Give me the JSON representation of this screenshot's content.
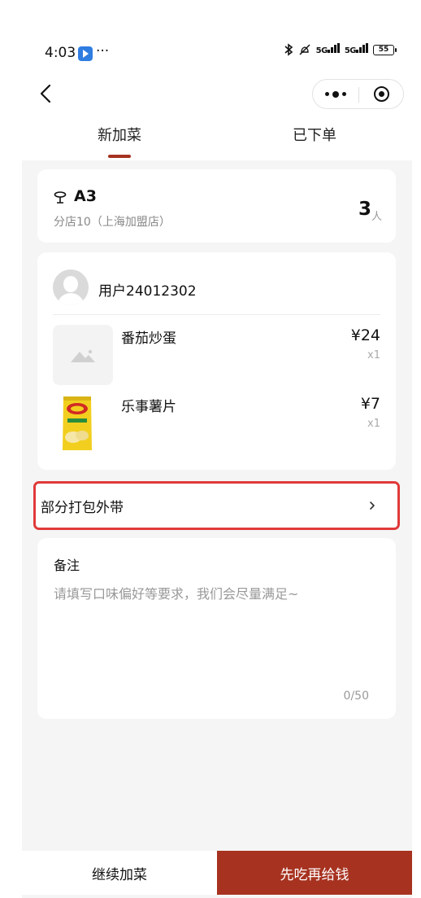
{
  "status_bar": {
    "time": "4:03",
    "dots": "···",
    "network_1": "5G",
    "network_2": "5G",
    "battery": "55"
  },
  "tabs": [
    {
      "label": "新加菜",
      "active": true
    },
    {
      "label": "已下单",
      "active": false
    }
  ],
  "table": {
    "name": "A3",
    "shop": "分店10（上海加盟店）",
    "guest_count": "3",
    "guest_unit": "人"
  },
  "order": {
    "username": "用户24012302",
    "items": [
      {
        "name": "番茄炒蛋",
        "price": "¥24",
        "qty": "x1",
        "thumb": "placeholder-image"
      },
      {
        "name": "乐事薯片",
        "price": "¥7",
        "qty": "x1",
        "thumb": "chips-photo"
      }
    ]
  },
  "packing": {
    "label": "部分打包外带",
    "arrow": "›"
  },
  "remark": {
    "title": "备注",
    "placeholder": "请填写口味偏好等要求，我们会尽量满足~",
    "value": "",
    "counter": "0/50"
  },
  "actions": {
    "continue_label": "继续加菜",
    "submit_label": "先吃再给钱"
  },
  "colors": {
    "accent": "#a73220",
    "highlight_border": "#e03a3a",
    "page_background": "#f5f5f5"
  }
}
